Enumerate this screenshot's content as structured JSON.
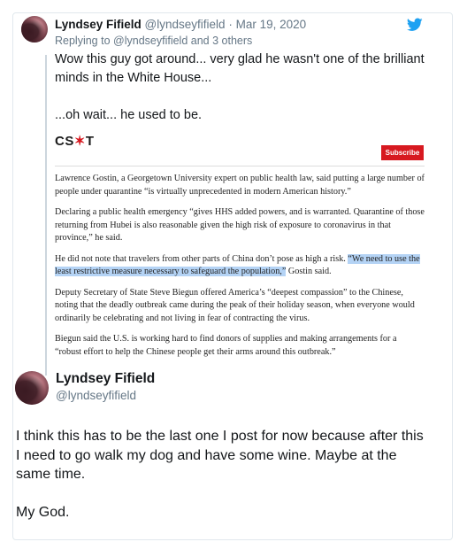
{
  "tweet1": {
    "name": "Lyndsey Fifield",
    "handle": "@lyndseyfifield",
    "separator": "·",
    "date": "Mar 19, 2020",
    "reply_prefix": "Replying to",
    "reply_mention": "@lyndseyfifield",
    "reply_suffix": "and 3 others",
    "text_line1": "Wow this guy got around... very glad he wasn't one of the brilliant minds in the White House...",
    "text_line2": "...oh wait... he used to be.",
    "icon": "twitter-bird-icon",
    "accent_color": "#1da1f2"
  },
  "article": {
    "logo_left": "CS",
    "logo_star": "✶",
    "logo_right": "T",
    "subscribe_label": "Subscribe",
    "p1": "Lawrence Gostin, a Georgetown University expert on public health law, said putting a large number of people under quarantine “is virtually unprecedented in modern American history.”",
    "p2": "Declaring a public health emergency “gives HHS added powers, and is warranted. Quarantine of those returning from Hubei is also reasonable given the high risk of exposure to coronavirus in that province,” he said.",
    "p3_before": "He did not note that travelers from other parts of China don’t pose as high a risk. ",
    "p3_highlight": "“We need to use the least restrictive measure necessary to safeguard the population,”",
    "p3_after": " Gostin said.",
    "p4": "Deputy Secretary of State Steve Biegun offered America’s “deepest compassion” to the Chinese, noting that the deadly outbreak came during the peak of their holiday season, when everyone would ordinarily be celebrating and not living in fear of contracting the virus.",
    "p5": "Biegun said the U.S. is working hard to find donors of supplies and making arrangements for a “robust effort to help the Chinese people get their arms around this outbreak.”",
    "brand_color": "#d71920",
    "highlight_color": "#b4d3f5"
  },
  "tweet2": {
    "name": "Lyndsey Fifield",
    "handle": "@lyndseyfifield",
    "text_line1": "I think this has to be the last one I post for now because after this I need to go walk my dog and have some wine. Maybe at the same time.",
    "text_line2": "My God."
  }
}
